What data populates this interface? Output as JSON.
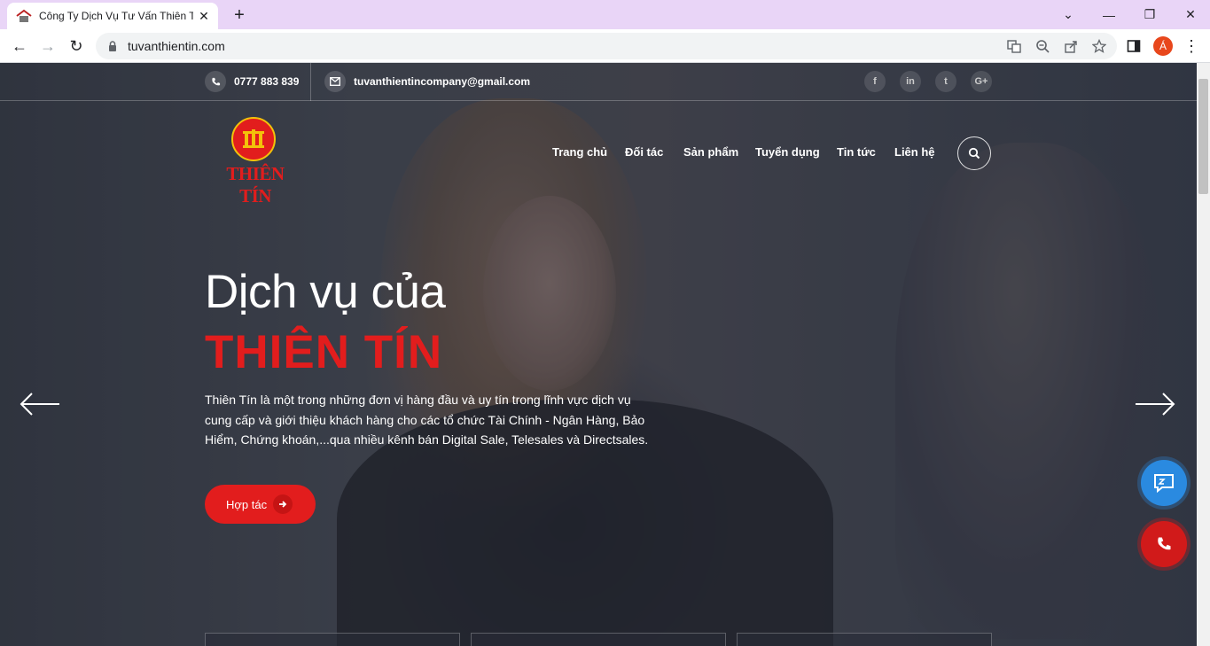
{
  "browser": {
    "tab_title": "Công Ty Dịch Vụ Tư Vấn Thiên Tín",
    "url": "tuvanthientin.com",
    "avatar_letter": "Á"
  },
  "topbar": {
    "phone": "0777 883 839",
    "email": "tuvanthientincompany@gmail.com",
    "social": [
      "f",
      "in",
      "t",
      "G+"
    ]
  },
  "header": {
    "logo_text": "THIÊN TÍN",
    "nav": [
      "Trang chủ",
      "Đối tác",
      "Sản phẩm",
      "Tuyển dụng",
      "Tin tức",
      "Liên hệ"
    ]
  },
  "hero": {
    "title_line1": "Dịch vụ của",
    "title_line2": "THIÊN TÍN",
    "description": "Thiên Tín là một trong những đơn vị hàng đầu và uy tín trong lĩnh vực dịch vụ cung cấp và giới thiệu khách hàng cho các tổ chức Tài Chính - Ngân Hàng, Bảo Hiểm, Chứng khoán,...qua nhiều kênh bán Digital Sale, Telesales và Directsales.",
    "cta_label": "Hợp tác"
  },
  "colors": {
    "brand_red": "#e21d1d",
    "brand_gold": "#f3c20a",
    "zalo_blue": "#2a8ae0",
    "tab_bar": "#e9d5f7"
  }
}
